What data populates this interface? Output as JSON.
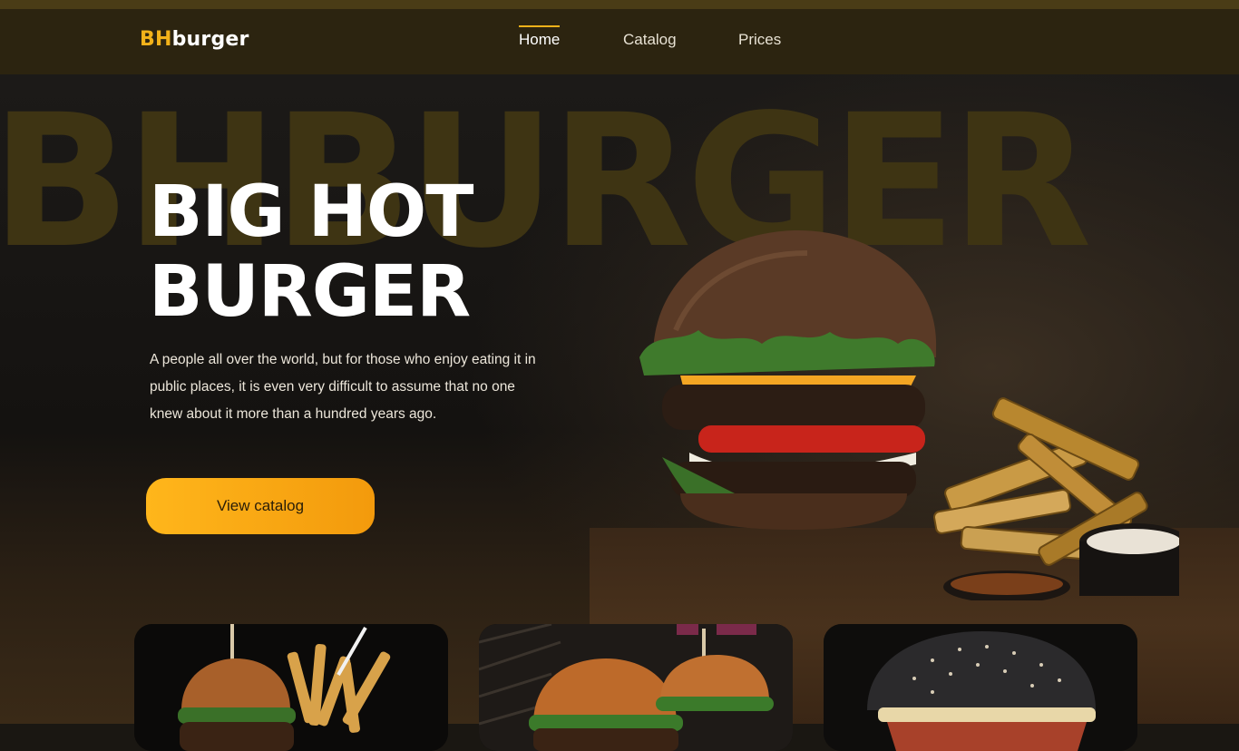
{
  "brand": {
    "logo_accent": "BH",
    "logo_rest": "burger",
    "accent_color": "#f2b21a"
  },
  "nav": {
    "items": [
      {
        "label": "Home",
        "active": true
      },
      {
        "label": "Catalog",
        "active": false
      },
      {
        "label": "Prices",
        "active": false
      }
    ]
  },
  "hero": {
    "watermark": "BHBURGER",
    "title_line1": "BIG HOT",
    "title_line2": "BURGER",
    "description": "A people all over the world, but for those who enjoy eating it in public places, it is even very difficult to assume that no one knew about it more than a hundred years ago.",
    "cta_label": "View catalog",
    "cta_color": "#ffb61b"
  },
  "cards": [
    {
      "image": "burger-and-fries-photo"
    },
    {
      "image": "two-burgers-photo"
    },
    {
      "image": "black-bun-burger-photo"
    }
  ]
}
